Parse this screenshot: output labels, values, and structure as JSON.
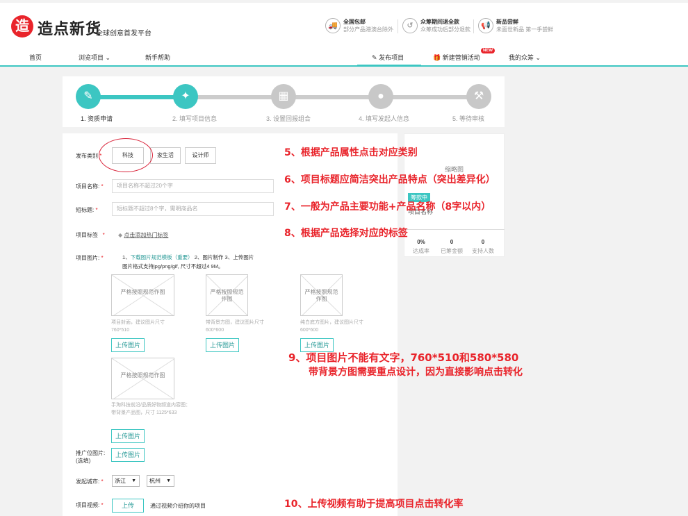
{
  "header": {
    "logo_glyph": "造",
    "logo_text": "造点新货",
    "slogan": "全球创意首发平台",
    "promises": [
      {
        "icon": "truck-icon",
        "glyph": "🚚",
        "title": "全国包邮",
        "sub": "部分产品港澳台除外"
      },
      {
        "icon": "refund-icon",
        "glyph": "↺",
        "title": "众筹期间退全款",
        "sub": "众筹成功后部分退款"
      },
      {
        "icon": "megaphone-icon",
        "glyph": "📢",
        "title": "新品尝鲜",
        "sub": "未面世新品 第一手尝鲜"
      }
    ],
    "nav": {
      "home": "首页",
      "browse": "浏览项目",
      "newbie": "新手帮助",
      "publish": "发布项目",
      "marketing": "新建营销活动",
      "new_badge": "NEW",
      "my": "我的众筹"
    }
  },
  "steps": [
    {
      "label": "1. 资质申请",
      "icon": "document-icon",
      "glyph": "✎",
      "active": true
    },
    {
      "label": "2. 填写项目信息",
      "icon": "lightbulb-icon",
      "glyph": "✦",
      "active": true
    },
    {
      "label": "3. 设置回报组合",
      "icon": "gift-icon",
      "glyph": "▦",
      "active": false
    },
    {
      "label": "4. 填写发起人信息",
      "icon": "person-icon",
      "glyph": "●",
      "active": false
    },
    {
      "label": "5. 等待审核",
      "icon": "gavel-icon",
      "glyph": "⚒",
      "active": false
    }
  ],
  "form": {
    "category_label": "发布类别",
    "categories": [
      "科技",
      "家生活",
      "设计师"
    ],
    "title_label": "项目名称:",
    "title_placeholder": "项目名称不超过20个字",
    "short_label": "短标题:",
    "short_placeholder": "短标题不超过8个字，需明商品名",
    "tags_label": "项目标签",
    "tags_link": "点击添加热门标签",
    "images_label": "项目图片:",
    "images_hint_1": "1、",
    "images_hint_link": "下载图片规范模板（重要）",
    "images_hint_2": "2、图片制作 3、上传图片",
    "images_hint_3": "图片格式支持jpg/png/gif, 尺寸不超过4 9M。",
    "image_slots": [
      {
        "placeholder": "严格按照规范作图",
        "caption": "项目封面，建议图片尺寸 760*510"
      },
      {
        "placeholder": "严格按照规范作图",
        "caption": "带背景方图，建议图片尺寸 600*600"
      },
      {
        "placeholder": "严格按照规范作图",
        "caption": "纯白底方图片，建议图片尺寸 600*600"
      },
      {
        "placeholder": "严格按照规范作图",
        "caption": "手淘科技前沿/品质好物频道内容图：带背景产品图，尺寸 1125*633"
      }
    ],
    "upload_label": "上传图片",
    "promo_label": "推广位图片:",
    "promo_sub": "(选填)",
    "city_label": "发起城市:",
    "province": "浙江",
    "city": "杭州",
    "video_label": "项目视频:",
    "video_btn": "上传",
    "video_hint": "通过视频介绍你的项目"
  },
  "preview": {
    "thumb": "缩略图",
    "badge": "筹款中",
    "name": "项目名称",
    "stats": [
      {
        "value": "0%",
        "key": "达成率"
      },
      {
        "value": "0",
        "key": "已筹金额"
      },
      {
        "value": "0",
        "key": "支持人数"
      }
    ]
  },
  "annotations": {
    "a5": "5、根据产品属性点击对应类别",
    "a6": "6、项目标题应简洁突出产品特点（突出差异化）",
    "a7": "7、一般为产品主要功能+产品名称（8字以内）",
    "a8": "8、根据产品选择对应的标签",
    "a9_1": "9、项目图片不能有文字，760*510和580*580",
    "a9_2": "带背景方图需要重点设计，因为直接影响点击转化",
    "a10": "10、上传视频有助于提高项目点击转化率"
  },
  "colors": {
    "accent": "#3cc6c2",
    "brand": "#e9242b",
    "step_inactive": "#cccccc"
  }
}
